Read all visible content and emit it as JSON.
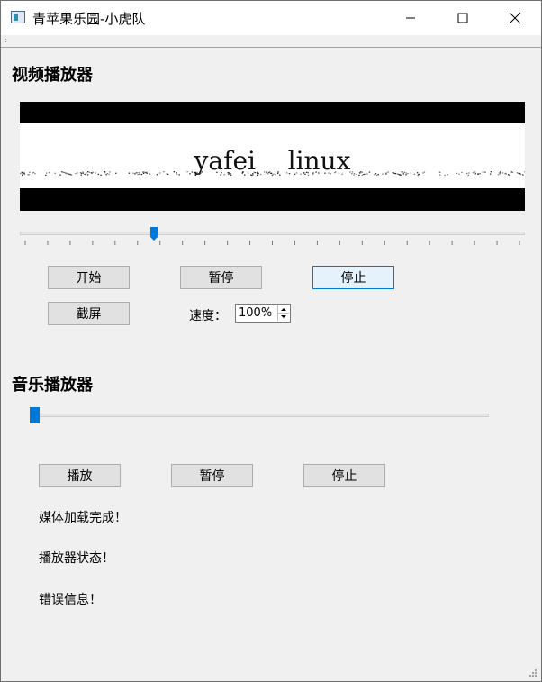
{
  "window": {
    "title": "青苹果乐园-小虎队"
  },
  "video_player": {
    "heading": "视频播放器",
    "caption": "yafei    linux",
    "progress_fraction": 0.265,
    "buttons": {
      "start": "开始",
      "pause": "暂停",
      "stop": "停止",
      "screenshot": "截屏"
    },
    "speed_label": "速度：",
    "speed_value": "100%"
  },
  "music_player": {
    "heading": "音乐播放器",
    "progress_fraction": 0.0,
    "buttons": {
      "play": "播放",
      "pause": "暂停",
      "stop": "停止"
    },
    "status_lines": {
      "media": "媒体加载完成！",
      "player": "播放器状态！",
      "error": "错误信息！"
    }
  },
  "colors": {
    "accent": "#0078d7",
    "window_bg": "#f0f0f0"
  },
  "icons": [
    "app-icon",
    "minimize-icon",
    "maximize-icon",
    "close-icon",
    "spin-up-icon",
    "spin-down-icon",
    "size-grip-icon"
  ]
}
